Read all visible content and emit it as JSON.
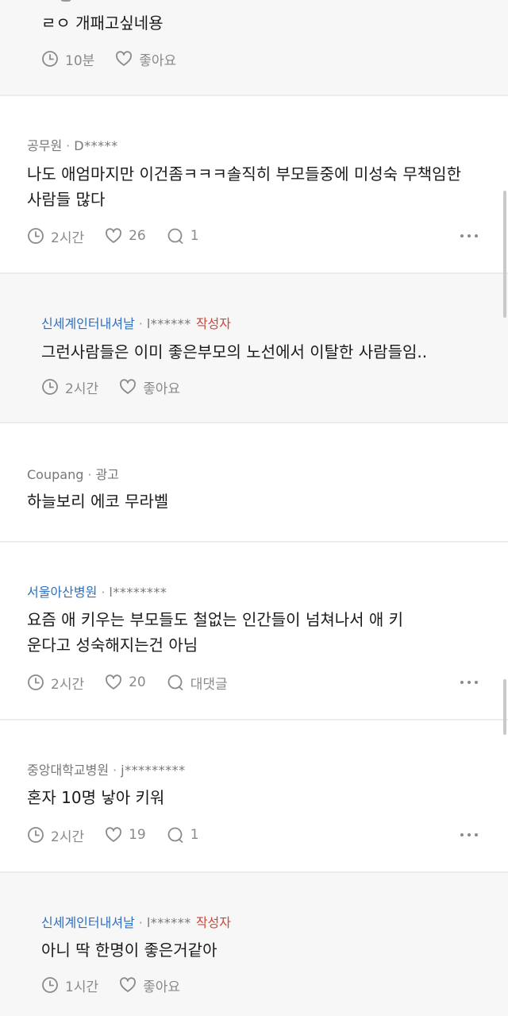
{
  "items": [
    {
      "body": "ㄹㅇ 개패고싶네용",
      "time": "10분",
      "like_label": "좋아요"
    },
    {
      "company": "공무원",
      "author": "D*****",
      "body": "나도 애엄마지만 이건좀ㅋㅋㅋ솔직히 부모들중에 미성숙 무책임한사람들 많다",
      "time": "2시간",
      "likes": "26",
      "comments": "1"
    },
    {
      "company": "신세계인터내셔날",
      "author": "l******",
      "op_badge": "작성자",
      "body": "그런사람들은 이미 좋은부모의 노선에서 이탈한 사람들임..",
      "time": "2시간",
      "like_label": "좋아요"
    },
    {
      "company": "Coupang",
      "ad_label": "광고",
      "body": "하늘보리 에코 무라벨"
    },
    {
      "company": "서울아산병원",
      "author": "l********",
      "body": "요즘 애 키우는 부모들도 철없는 인간들이 넘쳐나서 애 키운다고 성숙해지는건 아님",
      "time": "2시간",
      "likes": "20",
      "comment_label": "대댓글"
    },
    {
      "company": "중앙대학교병원",
      "author": "j*********",
      "body": "혼자 10명 낳아 키워",
      "time": "2시간",
      "likes": "19",
      "comments": "1"
    },
    {
      "company": "신세계인터내셔날",
      "author": "l******",
      "op_badge": "작성자",
      "body": "아니 딱 한명이 좋은거같아",
      "time": "1시간",
      "like_label": "좋아요"
    }
  ]
}
